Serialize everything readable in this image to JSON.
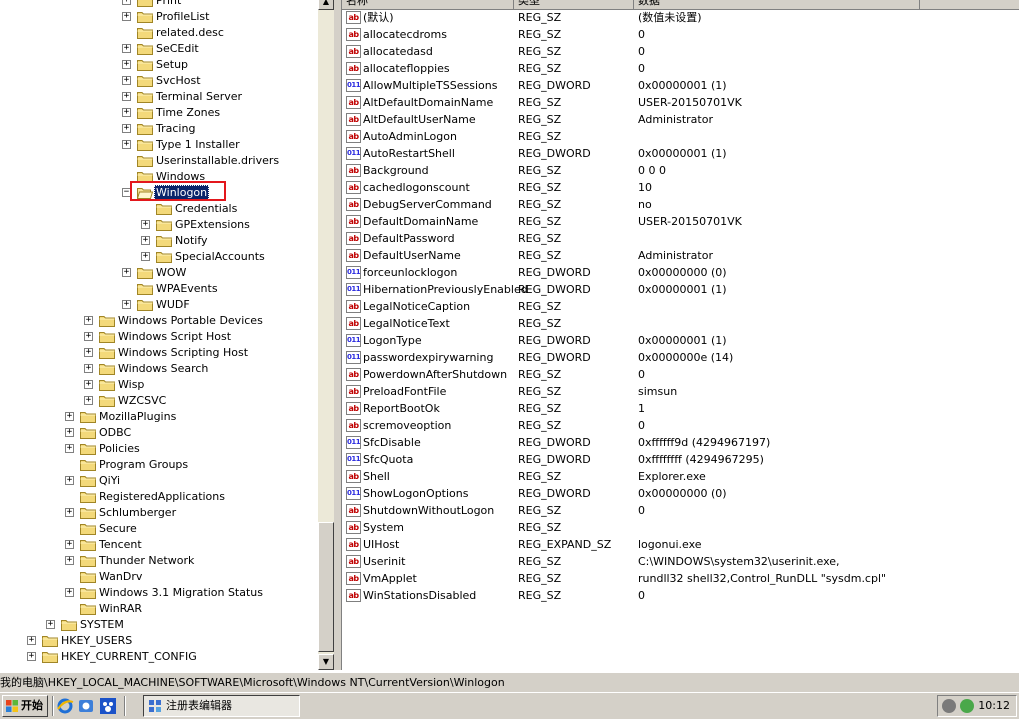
{
  "tree": {
    "expanders": {
      "plus": "+",
      "minus": "−"
    },
    "nodes": [
      {
        "label": "Print",
        "expander": "plus"
      },
      {
        "label": "ProfileList",
        "expander": "plus"
      },
      {
        "label": "related.desc",
        "expander": "none"
      },
      {
        "label": "SeCEdit",
        "expander": "plus"
      },
      {
        "label": "Setup",
        "expander": "plus"
      },
      {
        "label": "SvcHost",
        "expander": "plus"
      },
      {
        "label": "Terminal Server",
        "expander": "plus"
      },
      {
        "label": "Time Zones",
        "expander": "plus"
      },
      {
        "label": "Tracing",
        "expander": "plus"
      },
      {
        "label": "Type 1 Installer",
        "expander": "plus"
      },
      {
        "label": "Userinstallable.drivers",
        "expander": "none"
      },
      {
        "label": "Windows",
        "expander": "none"
      },
      {
        "label": "Winlogon",
        "expander": "minus",
        "selected": true,
        "open": true
      },
      {
        "label": "Credentials",
        "expander": "none"
      },
      {
        "label": "GPExtensions",
        "expander": "plus"
      },
      {
        "label": "Notify",
        "expander": "plus"
      },
      {
        "label": "SpecialAccounts",
        "expander": "plus"
      },
      {
        "label": "WOW",
        "expander": "plus"
      },
      {
        "label": "WPAEvents",
        "expander": "none"
      },
      {
        "label": "WUDF",
        "expander": "plus"
      },
      {
        "label": "Windows Portable Devices",
        "expander": "plus"
      },
      {
        "label": "Windows Script Host",
        "expander": "plus"
      },
      {
        "label": "Windows Scripting Host",
        "expander": "plus"
      },
      {
        "label": "Windows Search",
        "expander": "plus"
      },
      {
        "label": "Wisp",
        "expander": "plus"
      },
      {
        "label": "WZCSVC",
        "expander": "plus"
      },
      {
        "label": "MozillaPlugins",
        "expander": "plus"
      },
      {
        "label": "ODBC",
        "expander": "plus"
      },
      {
        "label": "Policies",
        "expander": "plus"
      },
      {
        "label": "Program Groups",
        "expander": "none"
      },
      {
        "label": "QiYi",
        "expander": "plus"
      },
      {
        "label": "RegisteredApplications",
        "expander": "none"
      },
      {
        "label": "Schlumberger",
        "expander": "plus"
      },
      {
        "label": "Secure",
        "expander": "none"
      },
      {
        "label": "Tencent",
        "expander": "plus"
      },
      {
        "label": "Thunder Network",
        "expander": "plus"
      },
      {
        "label": "WanDrv",
        "expander": "none"
      },
      {
        "label": "Windows 3.1 Migration Status",
        "expander": "plus"
      },
      {
        "label": "WinRAR",
        "expander": "none"
      },
      {
        "label": "SYSTEM",
        "expander": "plus"
      },
      {
        "label": "HKEY_USERS",
        "expander": "plus"
      },
      {
        "label": "HKEY_CURRENT_CONFIG",
        "expander": "plus"
      }
    ]
  },
  "list": {
    "columns": {
      "name": "名称",
      "type": "类型",
      "data": "数据"
    },
    "rows": [
      {
        "name": "(默认)",
        "type": "REG_SZ",
        "data": "(数值未设置)",
        "kind": "sz"
      },
      {
        "name": "allocatecdroms",
        "type": "REG_SZ",
        "data": "0",
        "kind": "sz"
      },
      {
        "name": "allocatedasd",
        "type": "REG_SZ",
        "data": "0",
        "kind": "sz"
      },
      {
        "name": "allocatefloppies",
        "type": "REG_SZ",
        "data": "0",
        "kind": "sz"
      },
      {
        "name": "AllowMultipleTSSessions",
        "type": "REG_DWORD",
        "data": "0x00000001 (1)",
        "kind": "dw"
      },
      {
        "name": "AltDefaultDomainName",
        "type": "REG_SZ",
        "data": "USER-20150701VK",
        "kind": "sz"
      },
      {
        "name": "AltDefaultUserName",
        "type": "REG_SZ",
        "data": "Administrator",
        "kind": "sz"
      },
      {
        "name": "AutoAdminLogon",
        "type": "REG_SZ",
        "data": "",
        "kind": "sz"
      },
      {
        "name": "AutoRestartShell",
        "type": "REG_DWORD",
        "data": "0x00000001 (1)",
        "kind": "dw"
      },
      {
        "name": "Background",
        "type": "REG_SZ",
        "data": "0 0 0",
        "kind": "sz"
      },
      {
        "name": "cachedlogonscount",
        "type": "REG_SZ",
        "data": "10",
        "kind": "sz"
      },
      {
        "name": "DebugServerCommand",
        "type": "REG_SZ",
        "data": "no",
        "kind": "sz"
      },
      {
        "name": "DefaultDomainName",
        "type": "REG_SZ",
        "data": "USER-20150701VK",
        "kind": "sz"
      },
      {
        "name": "DefaultPassword",
        "type": "REG_SZ",
        "data": "",
        "kind": "sz"
      },
      {
        "name": "DefaultUserName",
        "type": "REG_SZ",
        "data": "Administrator",
        "kind": "sz"
      },
      {
        "name": "forceunlocklogon",
        "type": "REG_DWORD",
        "data": "0x00000000 (0)",
        "kind": "dw"
      },
      {
        "name": "HibernationPreviouslyEnabled",
        "type": "REG_DWORD",
        "data": "0x00000001 (1)",
        "kind": "dw"
      },
      {
        "name": "LegalNoticeCaption",
        "type": "REG_SZ",
        "data": "",
        "kind": "sz"
      },
      {
        "name": "LegalNoticeText",
        "type": "REG_SZ",
        "data": "",
        "kind": "sz"
      },
      {
        "name": "LogonType",
        "type": "REG_DWORD",
        "data": "0x00000001 (1)",
        "kind": "dw"
      },
      {
        "name": "passwordexpirywarning",
        "type": "REG_DWORD",
        "data": "0x0000000e (14)",
        "kind": "dw"
      },
      {
        "name": "PowerdownAfterShutdown",
        "type": "REG_SZ",
        "data": "0",
        "kind": "sz"
      },
      {
        "name": "PreloadFontFile",
        "type": "REG_SZ",
        "data": "simsun",
        "kind": "sz"
      },
      {
        "name": "ReportBootOk",
        "type": "REG_SZ",
        "data": "1",
        "kind": "sz"
      },
      {
        "name": "scremoveoption",
        "type": "REG_SZ",
        "data": "0",
        "kind": "sz"
      },
      {
        "name": "SfcDisable",
        "type": "REG_DWORD",
        "data": "0xffffff9d (4294967197)",
        "kind": "dw"
      },
      {
        "name": "SfcQuota",
        "type": "REG_DWORD",
        "data": "0xffffffff (4294967295)",
        "kind": "dw"
      },
      {
        "name": "Shell",
        "type": "REG_SZ",
        "data": "Explorer.exe",
        "kind": "sz"
      },
      {
        "name": "ShowLogonOptions",
        "type": "REG_DWORD",
        "data": "0x00000000 (0)",
        "kind": "dw"
      },
      {
        "name": "ShutdownWithoutLogon",
        "type": "REG_SZ",
        "data": "0",
        "kind": "sz"
      },
      {
        "name": "System",
        "type": "REG_SZ",
        "data": "",
        "kind": "sz"
      },
      {
        "name": "UIHost",
        "type": "REG_EXPAND_SZ",
        "data": "logonui.exe",
        "kind": "sz"
      },
      {
        "name": "Userinit",
        "type": "REG_SZ",
        "data": "C:\\WINDOWS\\system32\\userinit.exe,",
        "kind": "sz"
      },
      {
        "name": "VmApplet",
        "type": "REG_SZ",
        "data": "rundll32 shell32,Control_RunDLL \"sysdm.cpl\"",
        "kind": "sz"
      },
      {
        "name": "WinStationsDisabled",
        "type": "REG_SZ",
        "data": "0",
        "kind": "sz"
      }
    ],
    "icon_text": {
      "sz": "ab",
      "dw": "011"
    }
  },
  "status": {
    "path": "我的电脑\\HKEY_LOCAL_MACHINE\\SOFTWARE\\Microsoft\\Windows NT\\CurrentVersion\\Winlogon"
  },
  "taskbar": {
    "start_label": "开始",
    "task_label": "注册表编辑器",
    "clock": "10:12",
    "quicklaunch_icons": [
      "ie-icon",
      "outlook-express-icon",
      "msn-icon"
    ]
  },
  "colors": {
    "selection": "#0a246a",
    "highlight_box": "#e3171c",
    "chrome": "#d4d0c8",
    "sz_icon": "#c00000",
    "dword_icon": "#2a2ae0"
  }
}
